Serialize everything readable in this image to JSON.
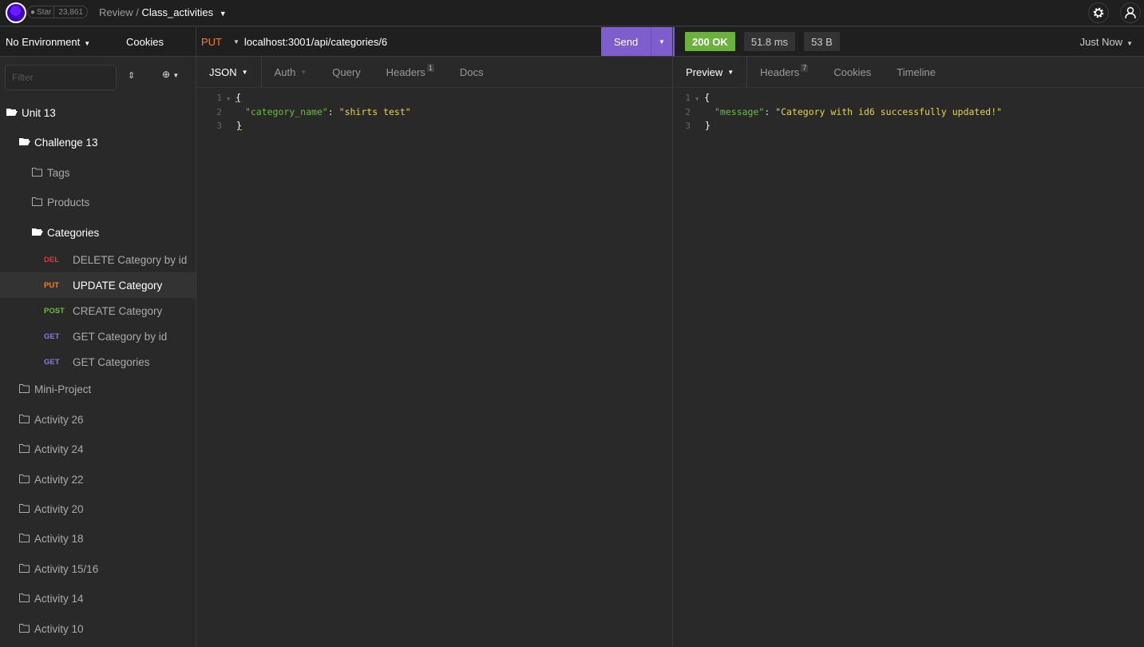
{
  "topbar": {
    "github_star_label": "Star",
    "github_star_count": "23,861",
    "breadcrumb_parent": "Review",
    "breadcrumb_separator": "/",
    "breadcrumb_current": "Class_activities",
    "settings_icon": "gear-icon",
    "account_icon": "user-icon"
  },
  "sidebar": {
    "environment": "No Environment",
    "cookies_label": "Cookies",
    "filter_placeholder": "Filter",
    "tree": [
      {
        "label": "Unit 13",
        "type": "folder",
        "open": true,
        "level": 0
      },
      {
        "label": "Challenge 13",
        "type": "folder",
        "open": true,
        "level": 1
      },
      {
        "label": "Tags",
        "type": "folder",
        "open": false,
        "level": 2
      },
      {
        "label": "Products",
        "type": "folder",
        "open": false,
        "level": 2
      },
      {
        "label": "Categories",
        "type": "folder",
        "open": true,
        "level": 2
      }
    ],
    "requests": [
      {
        "method": "DEL",
        "label": "DELETE Category by id",
        "color": "#e0393e"
      },
      {
        "method": "PUT",
        "label": "UPDATE Category",
        "color": "#f48120",
        "active": true
      },
      {
        "method": "POST",
        "label": "CREATE Category",
        "color": "#6bbc3c"
      },
      {
        "method": "GET",
        "label": "GET Category by id",
        "color": "#8b78e6"
      },
      {
        "method": "GET",
        "label": "GET Categories",
        "color": "#8b78e6"
      }
    ],
    "folders": [
      "Mini-Project",
      "Activity 26",
      "Activity 24",
      "Activity 22",
      "Activity 20",
      "Activity 18",
      "Activity 15/16",
      "Activity 14",
      "Activity 10"
    ]
  },
  "request": {
    "method": "PUT",
    "url": "localhost:3001/api/categories/6",
    "send_label": "Send",
    "tabs": [
      {
        "label": "JSON",
        "active": true
      },
      {
        "label": "Auth"
      },
      {
        "label": "Query"
      },
      {
        "label": "Headers",
        "badge": "1"
      },
      {
        "label": "Docs"
      }
    ],
    "body": {
      "lines": [
        "1",
        "2",
        "3"
      ],
      "open_brace": "{",
      "key": "\"category_name\"",
      "colon": ": ",
      "value": "\"shirts test\"",
      "close_brace": "}"
    }
  },
  "response": {
    "status": "200 OK",
    "time": "51.8 ms",
    "size": "53 B",
    "history": "Just Now",
    "tabs": [
      {
        "label": "Preview",
        "active": true
      },
      {
        "label": "Headers",
        "badge": "7"
      },
      {
        "label": "Cookies"
      },
      {
        "label": "Timeline"
      }
    ],
    "body": {
      "lines": [
        "1",
        "2",
        "3"
      ],
      "open_brace": "{",
      "key": "\"message\"",
      "colon": ": ",
      "value": "\"Category with id6 successfully updated!\"",
      "close_brace": "}"
    }
  },
  "colors": {
    "accent": "#7e5ecd",
    "status_ok": "#6ab13d",
    "put": "#f48120",
    "delete": "#e0393e",
    "post": "#6bbc3c",
    "get": "#8b78e6"
  }
}
